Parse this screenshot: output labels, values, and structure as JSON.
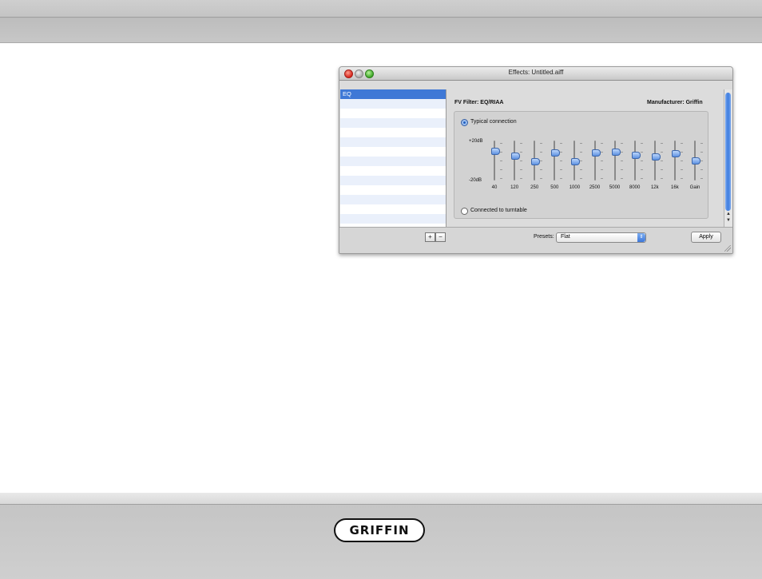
{
  "window": {
    "title": "Effects: Untitled.aiff"
  },
  "effects_list": {
    "items": [
      "EQ"
    ]
  },
  "panel": {
    "filter_label": "FV Filter: EQ/RIAA",
    "manufacturer_label": "Manufacturer: Griffin",
    "radio_typical": "Typical connection",
    "radio_turntable": "Connected to turntable",
    "selected_radio": "Typical connection",
    "db_top": "+20dB",
    "db_bottom": "-20dB"
  },
  "eq": {
    "range_db": [
      -20,
      20
    ],
    "bands": [
      {
        "label": "40",
        "value": 10
      },
      {
        "label": "120",
        "value": 5
      },
      {
        "label": "250",
        "value": -1
      },
      {
        "label": "500",
        "value": 8
      },
      {
        "label": "1000",
        "value": -1
      },
      {
        "label": "2500",
        "value": 8
      },
      {
        "label": "5000",
        "value": 9
      },
      {
        "label": "8000",
        "value": 6
      },
      {
        "label": "12k",
        "value": 4
      },
      {
        "label": "16k",
        "value": 7
      },
      {
        "label": "Gain",
        "value": 0
      }
    ]
  },
  "footer": {
    "add_label": "+",
    "remove_label": "−",
    "presets_label": "Presets:",
    "presets_value": "Flat",
    "apply_label": "Apply"
  },
  "brand": {
    "logo_text": "GRIFFIN"
  },
  "colors": {
    "selection": "#3f78d6",
    "knob": "#5f93e2"
  }
}
